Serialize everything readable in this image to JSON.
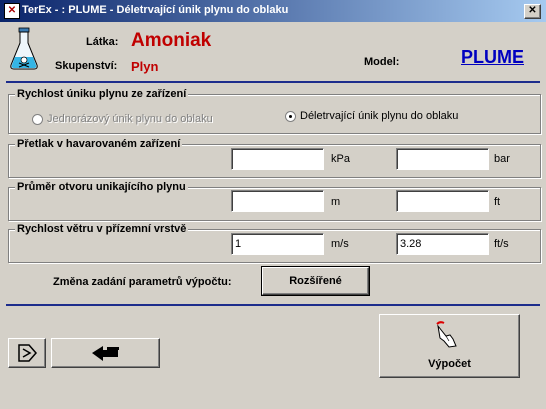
{
  "window": {
    "title": "TerEx - : PLUME - Déletrvající únik plynu do oblaku",
    "close_glyph": "✕"
  },
  "header": {
    "latka_label": "Látka:",
    "latka_value": "Amoniak",
    "skupenstvi_label": "Skupenství:",
    "skupenstvi_value": "Plyn",
    "model_label": "Model:",
    "model_value": "PLUME"
  },
  "rate_group": {
    "legend": "Rychlost úniku plynu ze zařízení",
    "option_single": "Jednorázový únik plynu do oblaku",
    "option_continuous": "Déletrvající únik plynu do oblaku",
    "selected": "continuous"
  },
  "pressure_group": {
    "legend": "Přetlak v havarovaném zařízení",
    "value1": "",
    "unit1": "kPa",
    "value2": "",
    "unit2": "bar"
  },
  "diameter_group": {
    "legend": "Průměr otvoru unikajícího plynu",
    "value1": "",
    "unit1": "m",
    "value2": "",
    "unit2": "ft"
  },
  "wind_group": {
    "legend": "Rychlost větru v přízemní vrstvě",
    "value1": "1",
    "unit1": "m/s",
    "value2": "3.28",
    "unit2": "ft/s"
  },
  "params": {
    "label": "Změna zadání parametrů výpočtu:",
    "button": "Rozšířené"
  },
  "footer": {
    "compute_label": "Výpočet"
  },
  "colors": {
    "accent_red": "#c00000",
    "model_blue": "#0000c0",
    "title_bar": "#0a246a"
  },
  "icons": [
    "flask-poison-icon",
    "exit-icon",
    "back-arrow-icon",
    "compute-hand-icon"
  ]
}
